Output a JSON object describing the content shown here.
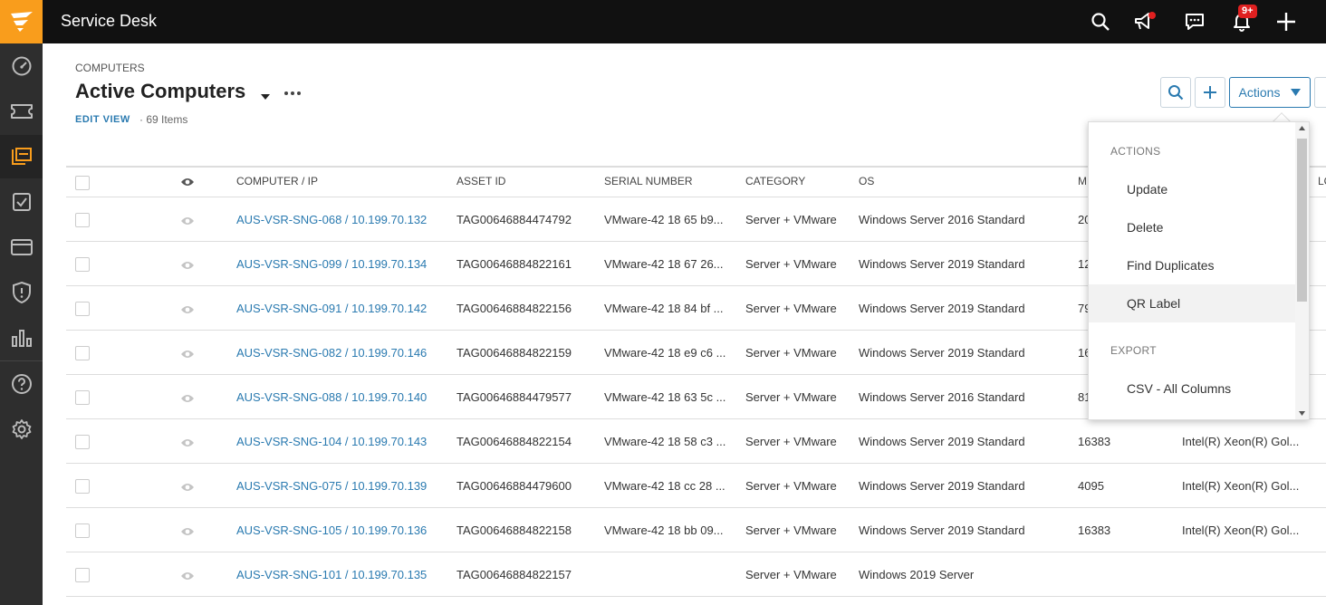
{
  "app": {
    "title": "Service Desk"
  },
  "topbar": {
    "notification_badge": "9+"
  },
  "sidebar": {
    "items": [
      {
        "name": "dashboard-icon"
      },
      {
        "name": "ticket-icon"
      },
      {
        "name": "assets-icon",
        "active": true
      },
      {
        "name": "tasks-icon"
      },
      {
        "name": "card-icon"
      },
      {
        "name": "shield-icon"
      },
      {
        "name": "reports-icon"
      },
      {
        "name": "help-icon"
      },
      {
        "name": "settings-icon"
      }
    ]
  },
  "header": {
    "breadcrumb": "COMPUTERS",
    "title": "Active Computers",
    "edit_view": "EDIT VIEW",
    "item_count": "· 69 Items"
  },
  "toolbar": {
    "actions_label": "Actions"
  },
  "table": {
    "columns": [
      "COMPUTER / IP",
      "ASSET ID",
      "SERIAL NUMBER",
      "CATEGORY",
      "OS",
      "M",
      "LO"
    ],
    "rows": [
      {
        "computer": "AUS-VSR-SNG-068 / 10.199.70.132",
        "asset_id": "TAG00646884474792",
        "serial": "VMware-42 18 65 b9...",
        "category": "Server + VMware",
        "os": "Windows Server 2016 Standard",
        "mem": "20",
        "cpu": ""
      },
      {
        "computer": "AUS-VSR-SNG-099 / 10.199.70.134",
        "asset_id": "TAG00646884822161",
        "serial": "VMware-42 18 67 26...",
        "category": "Server + VMware",
        "os": "Windows Server 2019 Standard",
        "mem": "12",
        "cpu": ""
      },
      {
        "computer": "AUS-VSR-SNG-091 / 10.199.70.142",
        "asset_id": "TAG00646884822156",
        "serial": "VMware-42 18 84 bf ...",
        "category": "Server + VMware",
        "os": "Windows Server 2019 Standard",
        "mem": "79",
        "cpu": ""
      },
      {
        "computer": "AUS-VSR-SNG-082 / 10.199.70.146",
        "asset_id": "TAG00646884822159",
        "serial": "VMware-42 18 e9 c6 ...",
        "category": "Server + VMware",
        "os": "Windows Server 2019 Standard",
        "mem": "16",
        "cpu": ""
      },
      {
        "computer": "AUS-VSR-SNG-088 / 10.199.70.140",
        "asset_id": "TAG00646884479577",
        "serial": "VMware-42 18 63 5c ...",
        "category": "Server + VMware",
        "os": "Windows Server 2016 Standard",
        "mem": "81",
        "cpu": ""
      },
      {
        "computer": "AUS-VSR-SNG-104 / 10.199.70.143",
        "asset_id": "TAG00646884822154",
        "serial": "VMware-42 18 58 c3 ...",
        "category": "Server + VMware",
        "os": "Windows Server 2019 Standard",
        "mem": "16383",
        "cpu": "Intel(R) Xeon(R) Gol..."
      },
      {
        "computer": "AUS-VSR-SNG-075 / 10.199.70.139",
        "asset_id": "TAG00646884479600",
        "serial": "VMware-42 18 cc 28 ...",
        "category": "Server + VMware",
        "os": "Windows Server 2019 Standard",
        "mem": "4095",
        "cpu": "Intel(R) Xeon(R) Gol..."
      },
      {
        "computer": "AUS-VSR-SNG-105 / 10.199.70.136",
        "asset_id": "TAG00646884822158",
        "serial": "VMware-42 18 bb 09...",
        "category": "Server + VMware",
        "os": "Windows Server 2019 Standard",
        "mem": "16383",
        "cpu": "Intel(R) Xeon(R) Gol..."
      },
      {
        "computer": "AUS-VSR-SNG-101 / 10.199.70.135",
        "asset_id": "TAG00646884822157",
        "serial": "",
        "category": "Server + VMware",
        "os": "Windows 2019 Server",
        "mem": "",
        "cpu": ""
      }
    ]
  },
  "dropdown": {
    "actions_header": "ACTIONS",
    "actions": [
      "Update",
      "Delete",
      "Find Duplicates",
      "QR Label"
    ],
    "export_header": "EXPORT",
    "export": [
      "CSV - All Columns"
    ]
  },
  "colors": {
    "brand": "#f99d1c",
    "link": "#2a7ab0",
    "topbar": "#111111",
    "sidebar": "#2e2e2e"
  }
}
